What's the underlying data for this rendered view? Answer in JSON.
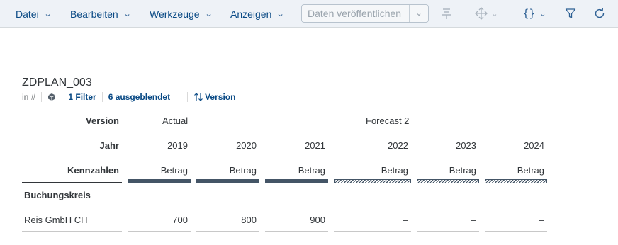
{
  "toolbar": {
    "menus": [
      "Datei",
      "Bearbeiten",
      "Werkzeuge",
      "Anzeigen"
    ],
    "publish_label": "Daten veröffentlichen",
    "icons": [
      "pin-icon",
      "move-icon",
      "code-braces-icon",
      "filter-icon",
      "refresh-icon"
    ]
  },
  "table": {
    "title": "ZDPLAN_003",
    "subbar": {
      "in_label": "in #",
      "filter_label": "1 Filter",
      "hidden_label": "6 ausgeblendet",
      "version_label": "Version"
    },
    "row_labels": {
      "version": "Version",
      "jahr": "Jahr",
      "kennzahlen": "Kennzahlen",
      "buchungskreis": "Buchungskreis"
    },
    "versions": [
      "Actual",
      "Forecast 2"
    ],
    "years": [
      "2019",
      "2020",
      "2021",
      "2022",
      "2023",
      "2024"
    ],
    "measure": "Betrag",
    "row": {
      "label": "Reis GmbH CH",
      "values": [
        "700",
        "800",
        "900",
        "–",
        "–",
        "–"
      ]
    }
  },
  "colors": {
    "toolbar_bg": "#eef2f7",
    "link": "#0a4a85",
    "actual_bar": "#445566"
  }
}
